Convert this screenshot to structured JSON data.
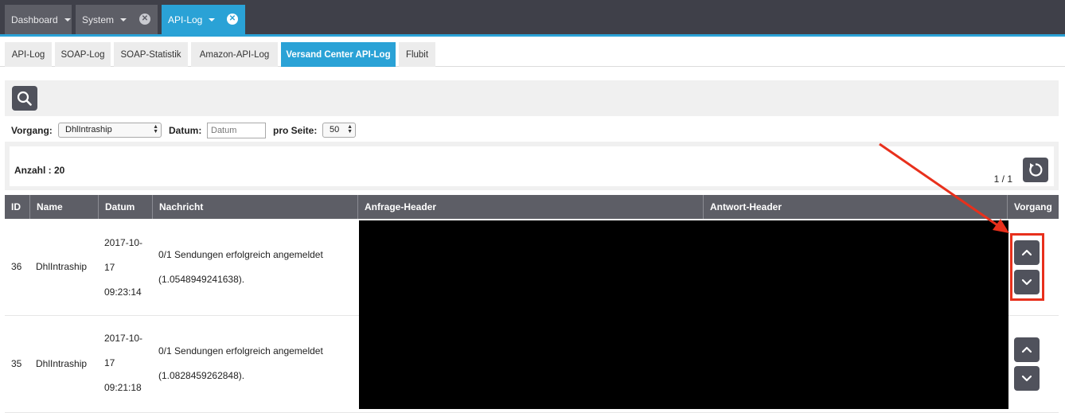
{
  "topbar": {
    "tabs": [
      {
        "label": "Dashboard"
      },
      {
        "label": "System"
      },
      {
        "label": "API-Log"
      }
    ]
  },
  "subtabs": [
    {
      "label": "API-Log"
    },
    {
      "label": "SOAP-Log"
    },
    {
      "label": "SOAP-Statistik"
    },
    {
      "label": "Amazon-API-Log"
    },
    {
      "label": "Versand Center API-Log"
    },
    {
      "label": "Flubit"
    }
  ],
  "filters": {
    "vorgang_label": "Vorgang:",
    "vorgang_value": "DhlIntraship",
    "datum_label": "Datum:",
    "datum_placeholder": "Datum",
    "pro_seite_label": "pro Seite:",
    "pro_seite_value": "50"
  },
  "summary": {
    "anzahl": "Anzahl : 20",
    "pager": "1 / 1"
  },
  "table": {
    "headers": [
      "ID",
      "Name",
      "Datum",
      "Nachricht",
      "Anfrage-Header",
      "Antwort-Header",
      "Vorgang"
    ],
    "rows": [
      {
        "id": "36",
        "name": "DhlIntraship",
        "date_lines": [
          "2017-10-",
          "17",
          "09:23:14"
        ],
        "message_lines": [
          "0/1 Sendungen erfolgreich angemeldet",
          "(1.0548949241638)."
        ]
      },
      {
        "id": "35",
        "name": "DhlIntraship",
        "date_lines": [
          "2017-10-",
          "17",
          "09:21:18"
        ],
        "message_lines": [
          "0/1 Sendungen erfolgreich angemeldet",
          "(1.0828459262848)."
        ]
      }
    ]
  },
  "icons": {
    "search": "search-icon",
    "refresh": "refresh-icon",
    "up": "chevron-up-icon",
    "down": "chevron-down-icon",
    "close": "close-icon"
  },
  "colors": {
    "accent": "#2aa2d6",
    "topbar": "#3f4049",
    "header": "#5d5e66",
    "annotation": "#e8301c"
  }
}
